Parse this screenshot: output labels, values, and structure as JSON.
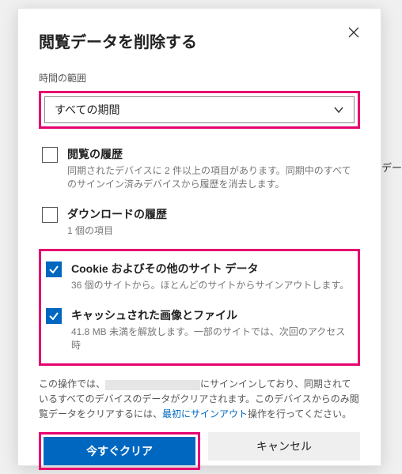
{
  "dialog": {
    "title": "閲覧データを削除する",
    "close_icon": "close-icon"
  },
  "range": {
    "label": "時間の範囲",
    "selected": "すべての期間"
  },
  "items": [
    {
      "title": "閲覧の履歴",
      "desc": "同期されたデバイスに 2 件以上の項目があります。同期中のすべてのサインイン済みデバイスから履歴を消去します。",
      "checked": false
    },
    {
      "title": "ダウンロードの履歴",
      "desc": "1 個の項目",
      "checked": false
    },
    {
      "title": "Cookie およびその他のサイト データ",
      "desc": "36 個のサイトから。ほとんどのサイトからサインアウトします。",
      "checked": true
    },
    {
      "title": "キャッシュされた画像とファイル",
      "desc": "41.8 MB 未満を解放します。一部のサイトでは、次回のアクセス時",
      "checked": true
    }
  ],
  "footer": {
    "part1": "この操作では、",
    "part2": "にサインインしており、同期されているすべてのデバイスのデータがクリアされます。このデバイスからのみ閲覧データをクリアするには、",
    "link": "最初にサインアウト",
    "part3": "操作を行ってください。"
  },
  "buttons": {
    "primary": "今すぐクリア",
    "secondary": "キャンセル"
  },
  "side": "デー"
}
